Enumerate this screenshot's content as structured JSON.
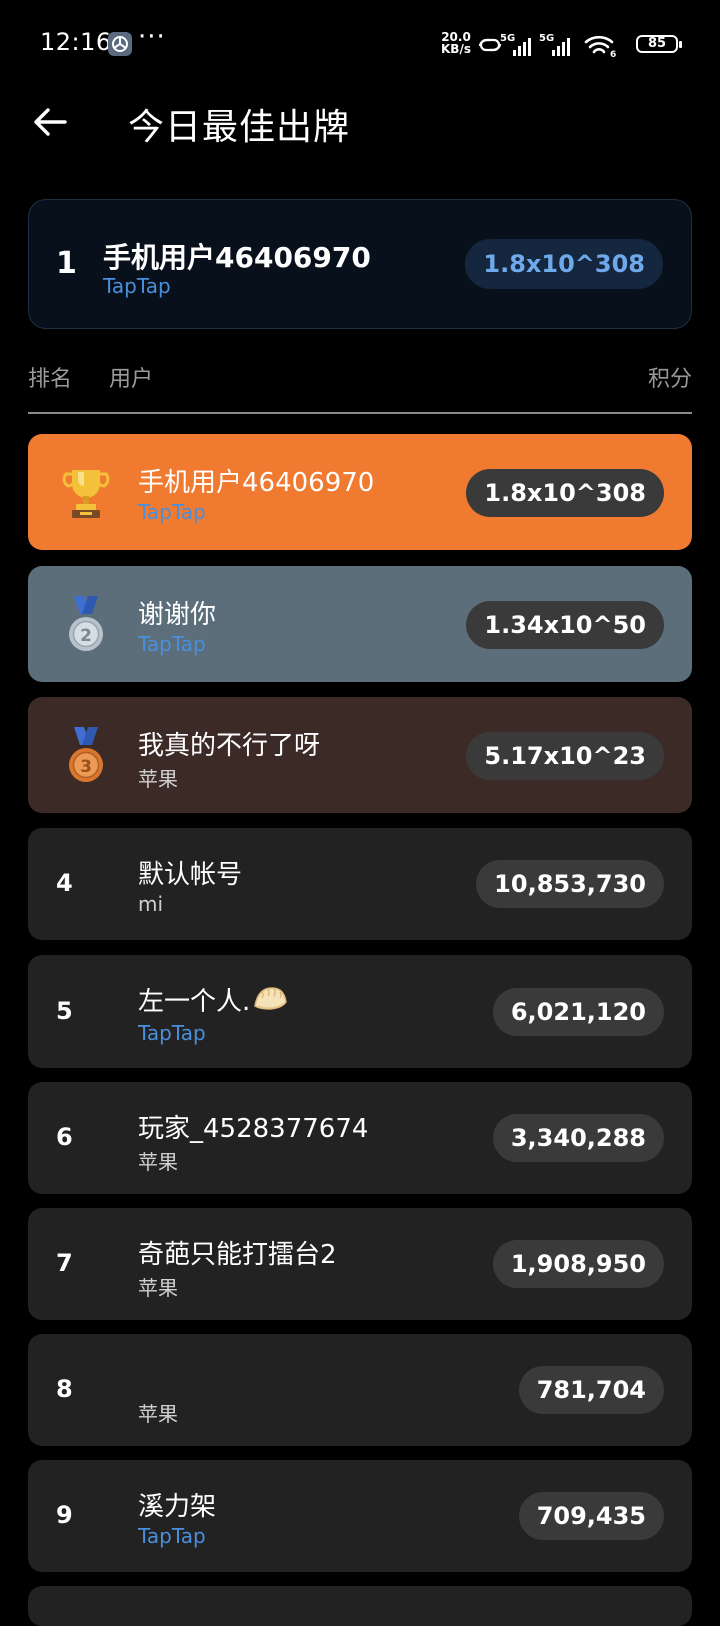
{
  "status_bar": {
    "time": "12:16",
    "dots": "···",
    "speed_value": "20.0",
    "speed_unit": "KB/s",
    "network_1": "5G",
    "network_2": "5G",
    "wifi_sub": "6",
    "battery": "85"
  },
  "header": {
    "title": "今日最佳出牌"
  },
  "my_entry": {
    "rank": "1",
    "name": "手机用户46406970",
    "platform": "TapTap",
    "score": "1.8x10^308"
  },
  "columns": {
    "rank": "排名",
    "user": "用户",
    "score": "积分"
  },
  "colors": {
    "gold_row": "#ef7a30",
    "silver_row": "#5b6e7a",
    "bronze_row": "#3b2a26",
    "default_row": "#222222",
    "taptap": "#4a8fdc",
    "accent": "#6fa9ec"
  },
  "rows": [
    {
      "rank": "1",
      "icon": "trophy-icon",
      "name": "手机用户46406970",
      "platform": "TapTap",
      "score": "1.8x10^308"
    },
    {
      "rank": "2",
      "icon": "silver-medal-icon",
      "name": "谢谢你",
      "platform": "TapTap",
      "score": "1.34x10^50"
    },
    {
      "rank": "3",
      "icon": "bronze-medal-icon",
      "name": "我真的不行了呀",
      "platform": "苹果",
      "score": "5.17x10^23"
    },
    {
      "rank": "4",
      "name": "默认帐号",
      "platform": "mi",
      "score": "10,853,730"
    },
    {
      "rank": "5",
      "name": "左一个人.",
      "platform": "TapTap",
      "score": "6,021,120",
      "trailing_icon": "dumpling-icon"
    },
    {
      "rank": "6",
      "name": "玩家_4528377674",
      "platform": "苹果",
      "score": "3,340,288"
    },
    {
      "rank": "7",
      "name": "奇葩只能打擂台2",
      "platform": "苹果",
      "score": "1,908,950"
    },
    {
      "rank": "8",
      "name": "",
      "platform": "苹果",
      "score": "781,704"
    },
    {
      "rank": "9",
      "name": "溪力架",
      "platform": "TapTap",
      "score": "709,435"
    }
  ]
}
